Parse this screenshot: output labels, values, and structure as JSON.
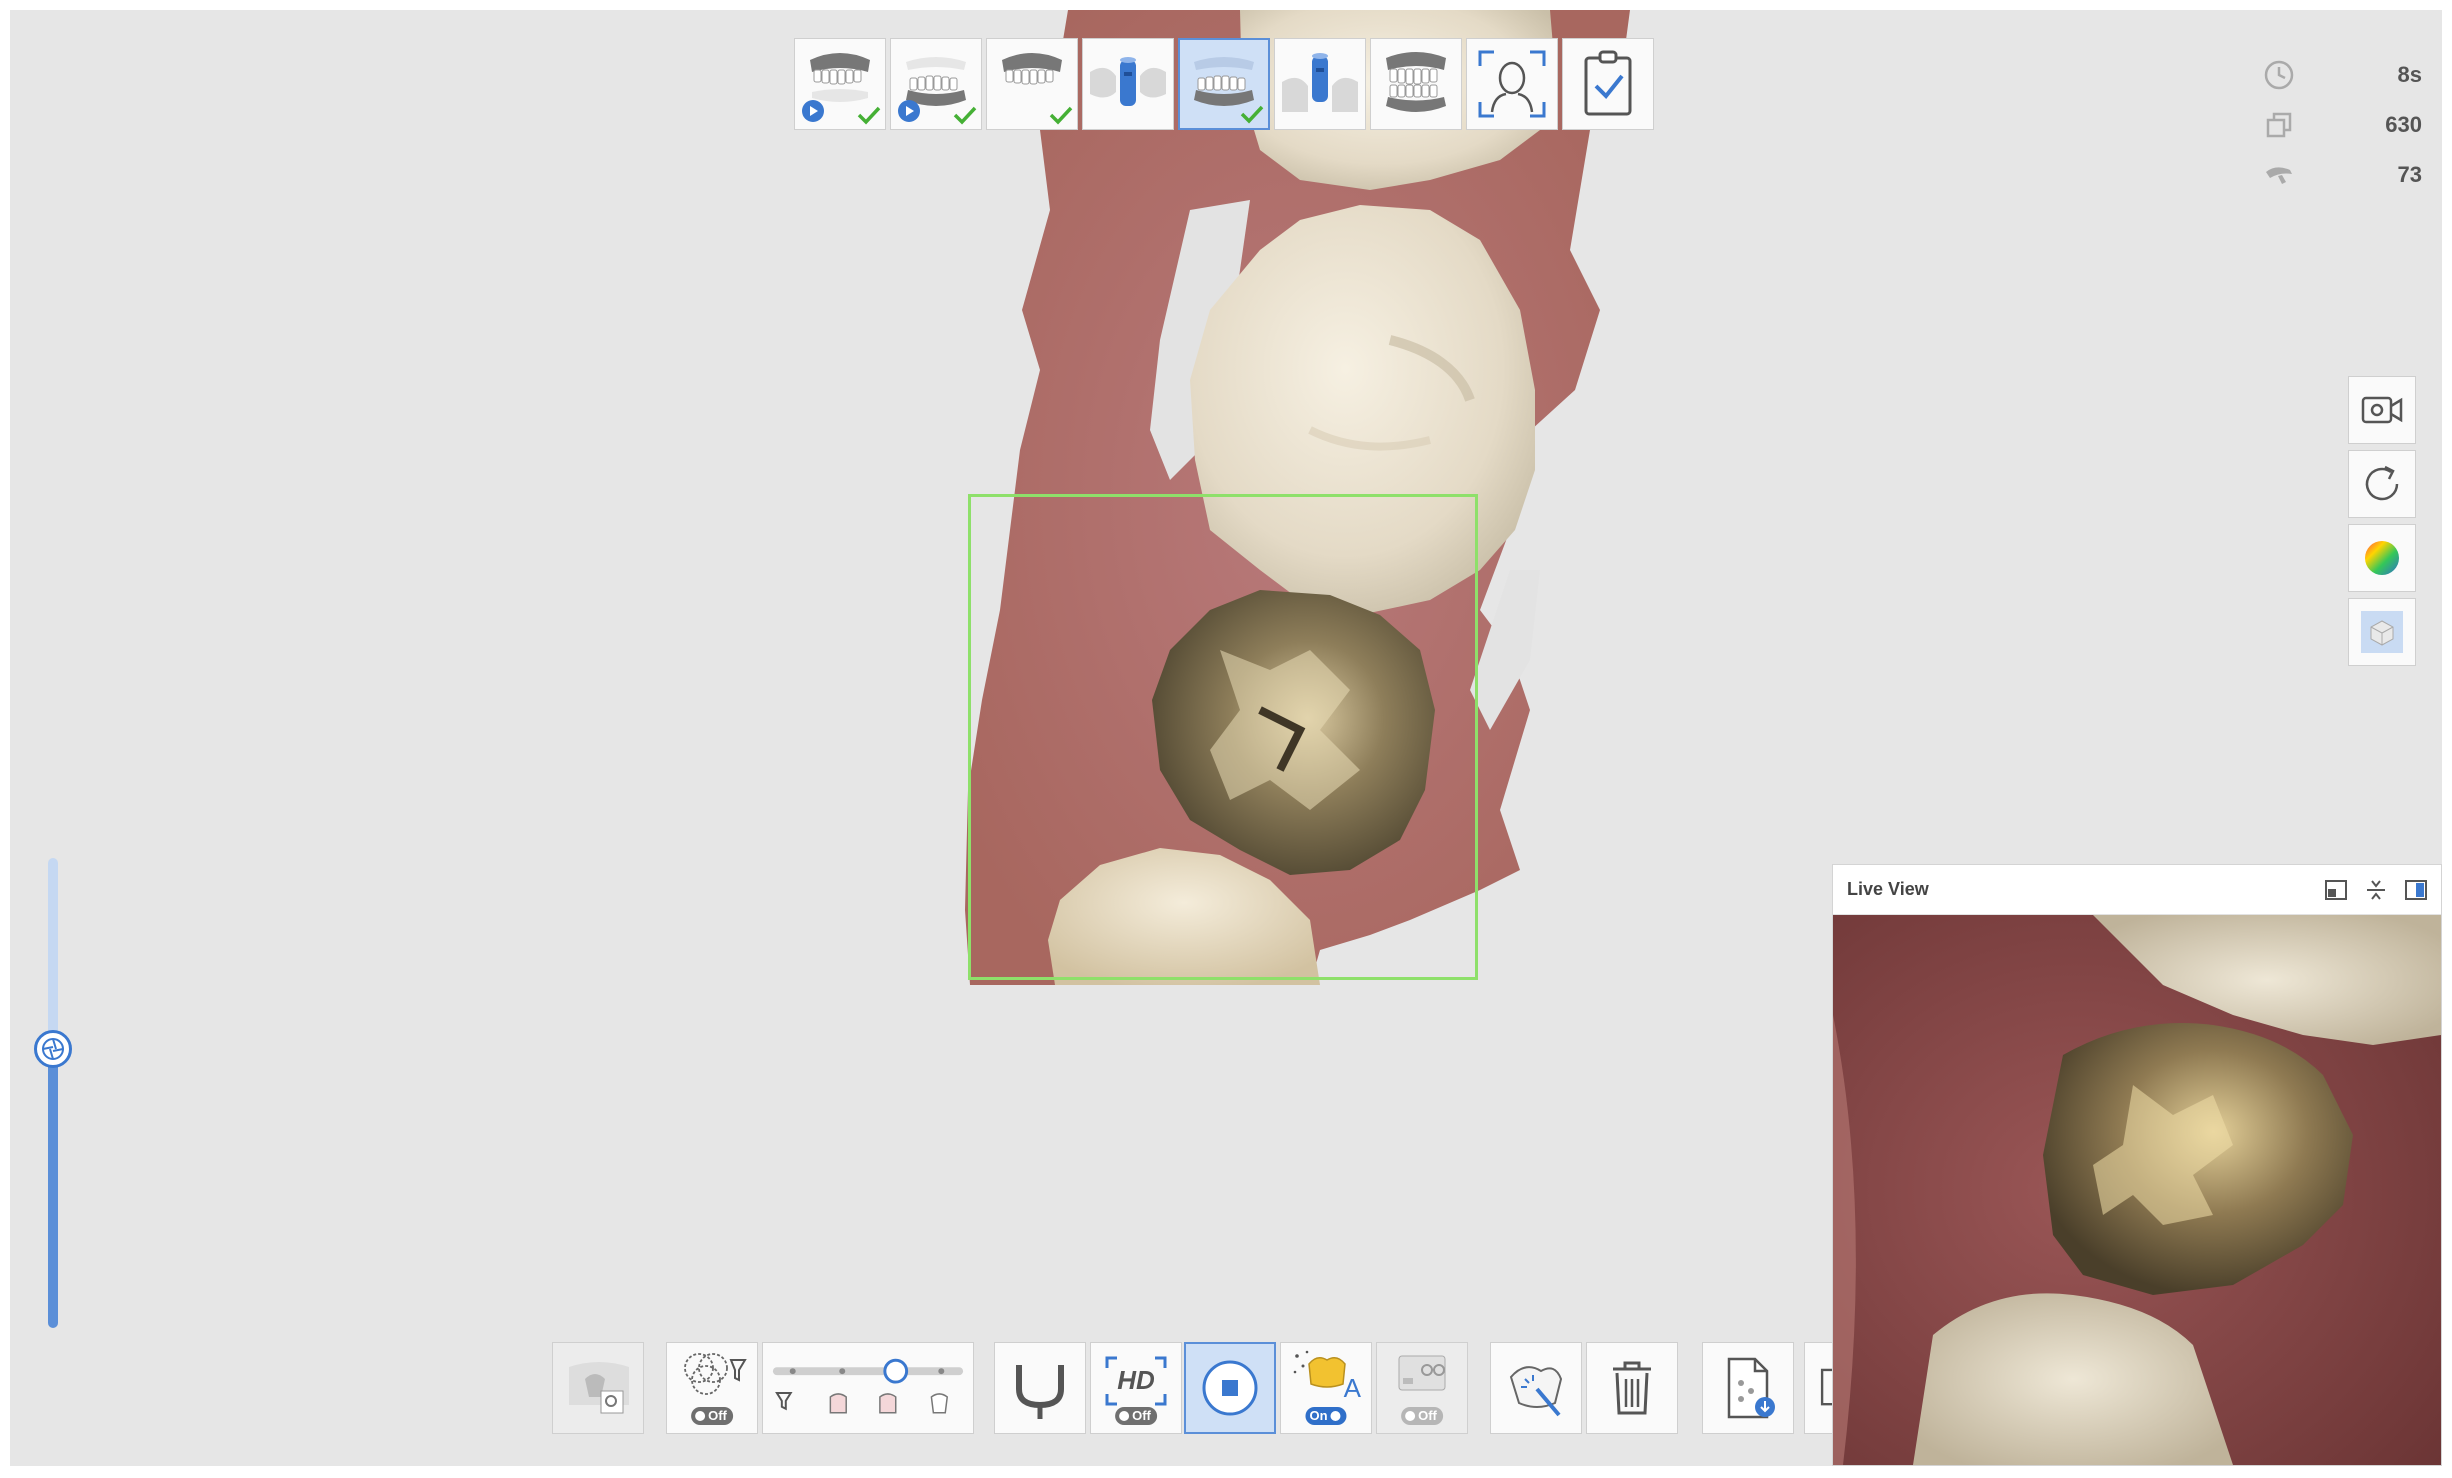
{
  "stats": {
    "time": "8s",
    "frames": "630",
    "shots": "73"
  },
  "live_view": {
    "title": "Live View"
  },
  "bottom_toolbar": {
    "filter_toggle": "Off",
    "hd_label": "HD",
    "hd_toggle": "Off",
    "ai_toggle": "On",
    "ai_letter": "A",
    "camera_toggle": "Off"
  },
  "stages": [
    {
      "icon": "maxilla-teeth-icon",
      "status": "done",
      "play": true
    },
    {
      "icon": "mandible-teeth-icon",
      "status": "done",
      "play": true
    },
    {
      "icon": "maxilla-teeth-icon",
      "status": "done",
      "play": false
    },
    {
      "icon": "scanbody-icon",
      "status": "none",
      "play": false
    },
    {
      "icon": "mandible-teeth-icon",
      "status": "done",
      "play": false,
      "active": true
    },
    {
      "icon": "scanbody-icon",
      "status": "none",
      "play": false
    },
    {
      "icon": "bite-icon",
      "status": "none",
      "play": false
    },
    {
      "icon": "face-scan-icon",
      "status": "none",
      "play": false
    },
    {
      "icon": "checklist-icon",
      "status": "none",
      "play": false
    }
  ],
  "colors": {
    "accent": "#5b8fd8",
    "selection_box": "#8ee06a",
    "check": "#45b035",
    "background": "#e6e6e6"
  }
}
